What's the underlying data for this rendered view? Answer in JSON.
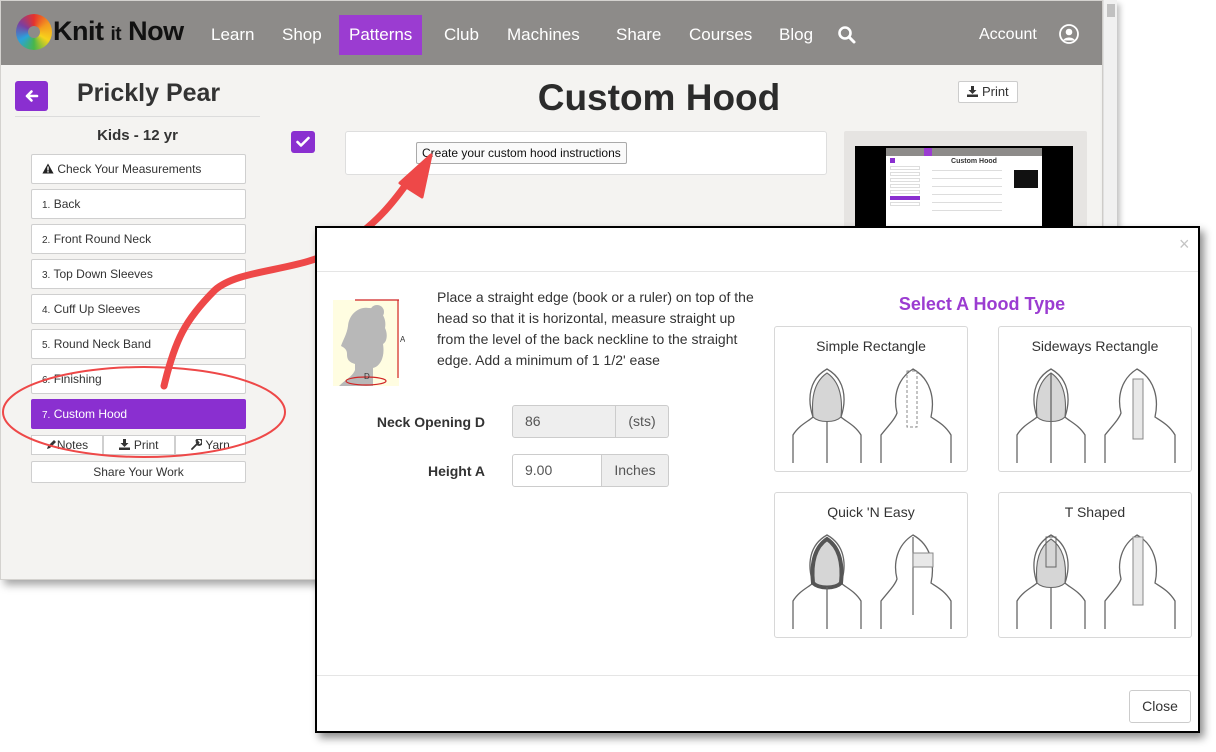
{
  "nav": {
    "logo": {
      "word1": "Knit",
      "word2": "it",
      "word3": "Now"
    },
    "items": [
      "Learn",
      "Shop",
      "Patterns",
      "Club",
      "Machines",
      "Share",
      "Courses",
      "Blog"
    ],
    "active_item": "Patterns",
    "account_label": "Account"
  },
  "sidebar": {
    "pattern_name": "Prickly Pear",
    "size": "Kids - 12 yr",
    "check_measurements": "Check Your Measurements",
    "steps": [
      {
        "num": "1.",
        "label": "Back"
      },
      {
        "num": "2.",
        "label": "Front Round Neck"
      },
      {
        "num": "3.",
        "label": "Top Down Sleeves"
      },
      {
        "num": "4.",
        "label": "Cuff Up Sleeves"
      },
      {
        "num": "5.",
        "label": "Round Neck Band"
      },
      {
        "num": "6.",
        "label": "Finishing"
      },
      {
        "num": "7.",
        "label": "Custom Hood"
      }
    ],
    "active_step": "Custom Hood",
    "tools": {
      "notes": "Notes",
      "print": "Print",
      "yarn": "Yarn"
    },
    "share": "Share Your Work"
  },
  "main": {
    "title": "Custom Hood",
    "print_label": "Print",
    "create_button": "Create your custom hood instructions",
    "preview_title": "Custom Hood"
  },
  "modal": {
    "close_x": "×",
    "instructions": "Place a straight edge (book or a ruler) on top of the head so that it is horizontal, measure straight up from the level of the back neckline to the straight edge. Add a minimum of 1 1/2' ease",
    "diagram_labels": {
      "a": "A",
      "d": "D"
    },
    "fields": [
      {
        "label": "Neck Opening D",
        "value": "86",
        "unit": "(sts)",
        "disabled": true
      },
      {
        "label": "Height A",
        "value": "9.00",
        "unit": "Inches",
        "disabled": false
      }
    ],
    "hood_heading": "Select A Hood Type",
    "hood_types": [
      "Simple Rectangle",
      "Sideways Rectangle",
      "Quick 'N Easy",
      "T Shaped"
    ],
    "close_button": "Close"
  },
  "colors": {
    "accent_purple": "#8a2fd0",
    "nav_gray": "#8d8b89",
    "annotation_red": "#ee4848"
  },
  "icons": [
    "arrow-left-icon",
    "warning-icon",
    "download-icon",
    "pencil-icon",
    "wrench-icon",
    "search-icon",
    "user-circle-icon",
    "check-icon",
    "close-icon"
  ]
}
